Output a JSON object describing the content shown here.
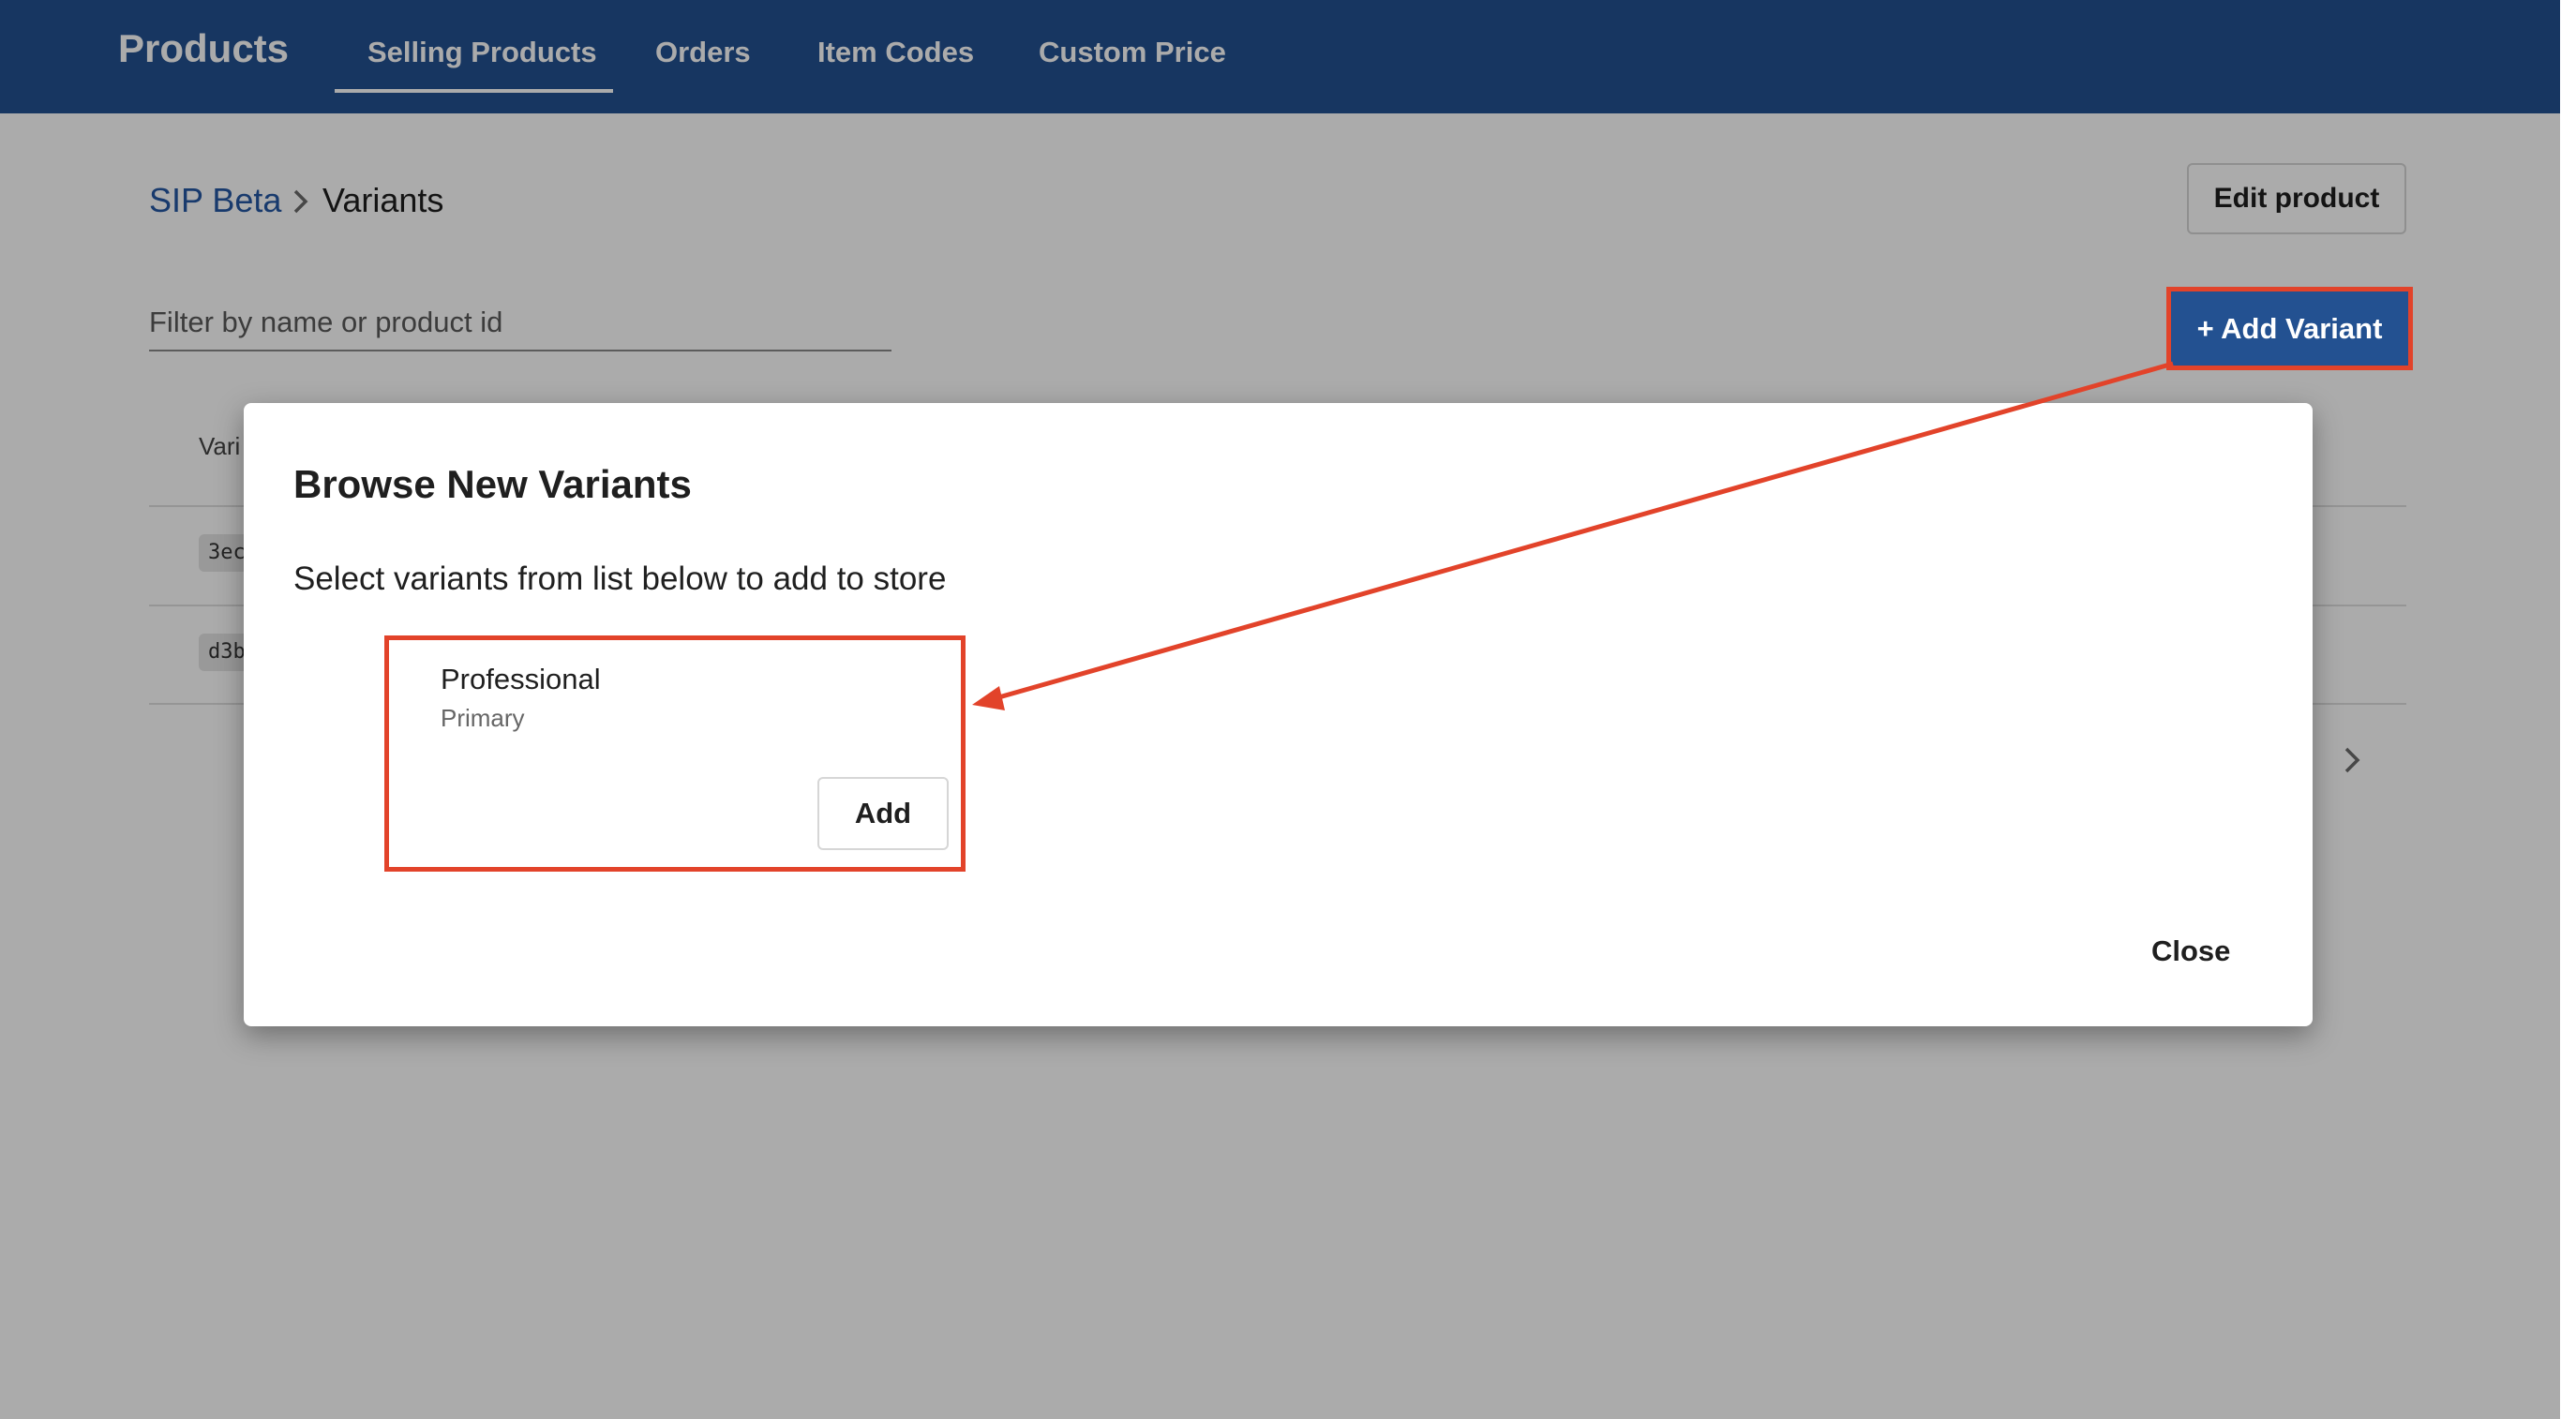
{
  "header": {
    "brand": "Products",
    "tabs": [
      {
        "label": "Selling Products",
        "active": true
      },
      {
        "label": "Orders"
      },
      {
        "label": "Item Codes"
      },
      {
        "label": "Custom Price"
      }
    ]
  },
  "breadcrumb": {
    "parent": "SIP Beta",
    "current": "Variants"
  },
  "toolbar": {
    "edit_product_label": "Edit product",
    "add_variant_label": "+ Add Variant",
    "filter_placeholder": "Filter by name or product id"
  },
  "table": {
    "header_partial": "Vari",
    "rows": [
      {
        "id_partial": "3ec"
      },
      {
        "id_partial": "d3b"
      }
    ]
  },
  "modal": {
    "title": "Browse New Variants",
    "subtitle": "Select variants from list below to add to store",
    "variants": [
      {
        "name": "Professional",
        "type": "Primary",
        "add_label": "Add"
      }
    ],
    "close_label": "Close"
  },
  "colors": {
    "header_bg": "#235191",
    "link": "#2457a3",
    "annotation": "#e2432a"
  }
}
